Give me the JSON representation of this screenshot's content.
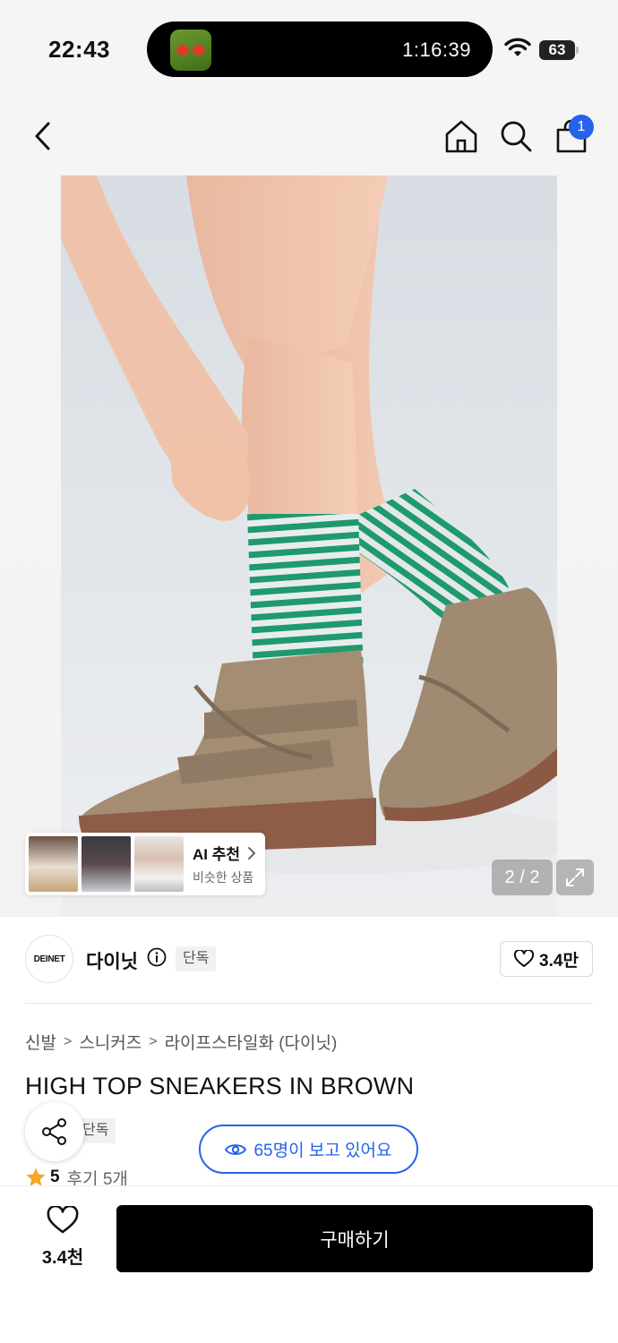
{
  "status_bar": {
    "time": "22:43",
    "live_activity_timer": "1:16:39",
    "battery": "63"
  },
  "header": {
    "cart_count": "1"
  },
  "gallery": {
    "ai_card": {
      "title": "AI 추천",
      "subtitle": "비슷한 상품"
    },
    "counter": "2 / 2"
  },
  "brand": {
    "logo_text": "DEINET",
    "name": "다이닛",
    "tag": "단독",
    "likes": "3.4만"
  },
  "breadcrumb": [
    "신발",
    "스니커즈",
    "라이프스타일화 (다이닛)"
  ],
  "product": {
    "title": "HIGH TOP SNEAKERS IN BROWN",
    "tag": "단독",
    "viewers_text": "65명이 보고 있어요",
    "rating": "5",
    "reviews": "후기 5개"
  },
  "bottom_bar": {
    "wish_count": "3.4천",
    "buy_label": "구매하기"
  },
  "colors": {
    "accent_blue": "#2563eb",
    "buy_button": "#000000",
    "star": "#f5a623"
  }
}
